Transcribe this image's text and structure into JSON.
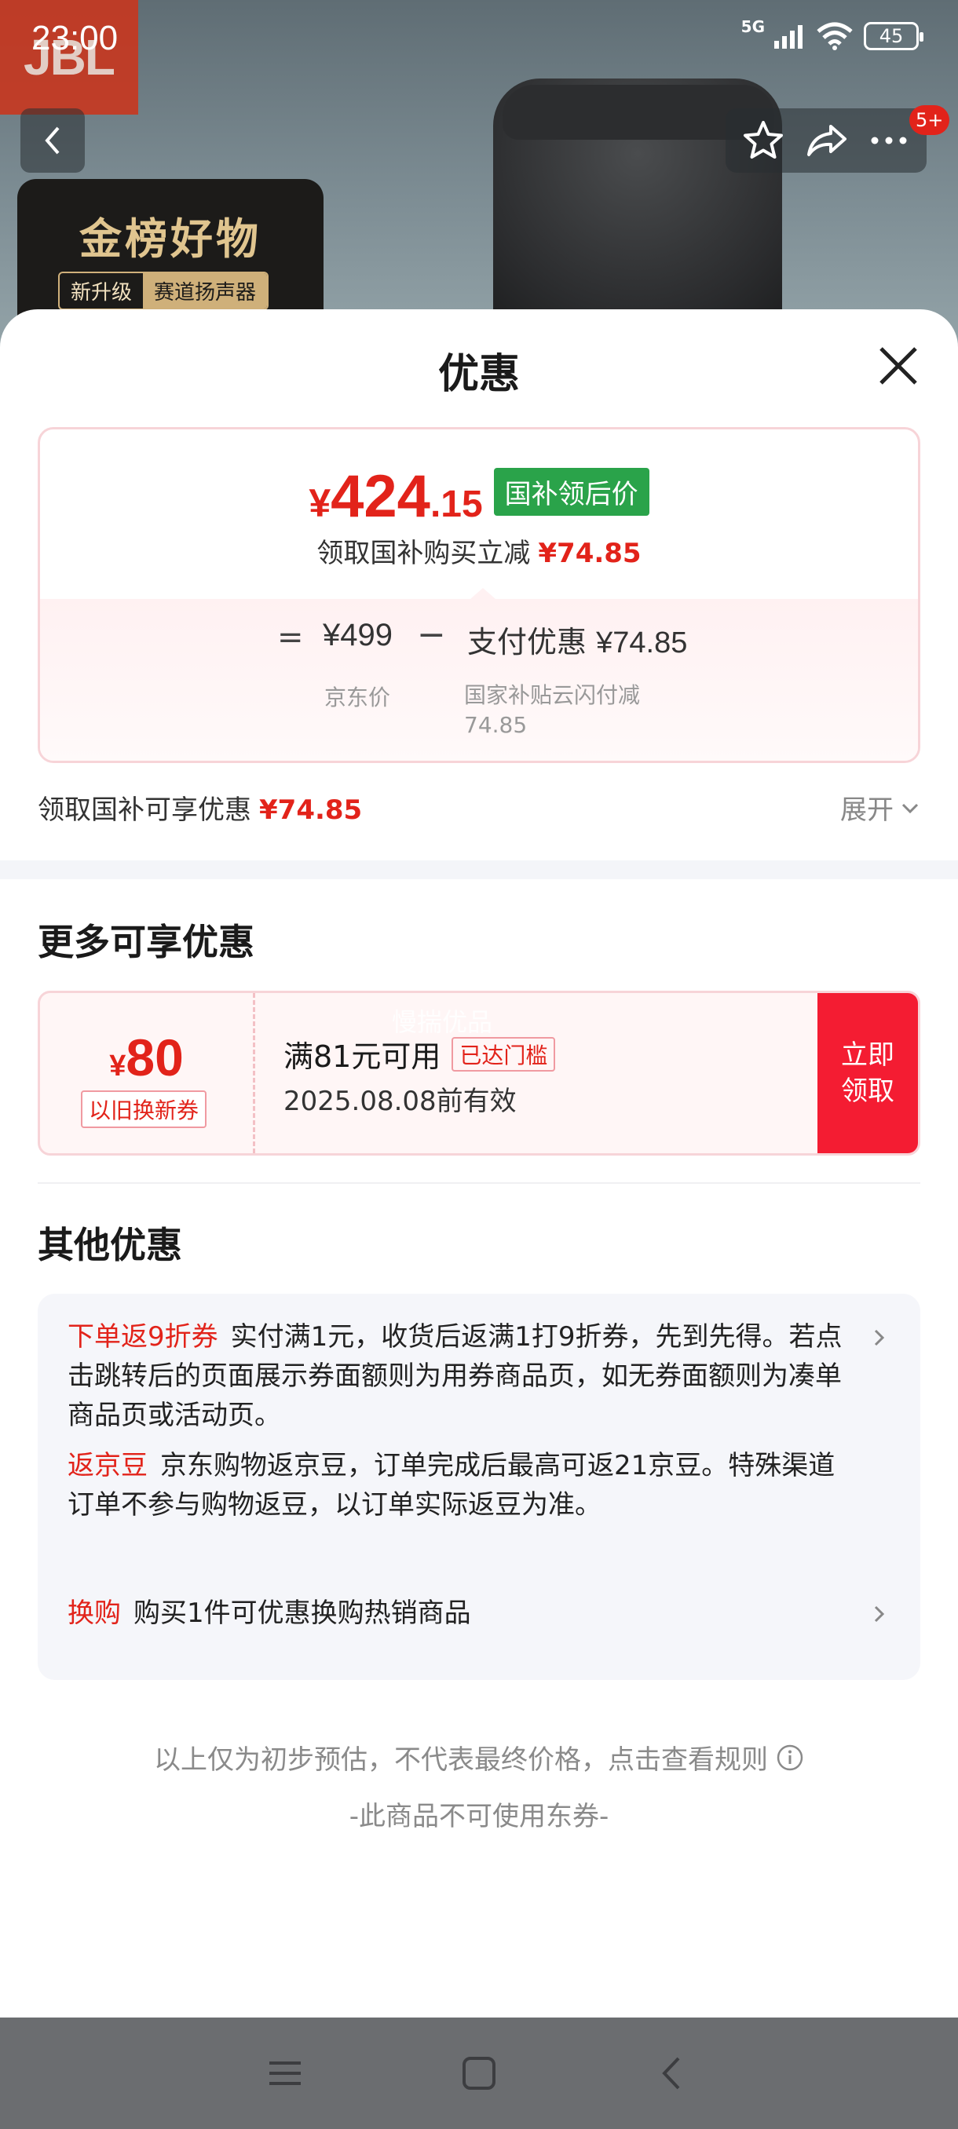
{
  "status_bar": {
    "time": "23:00",
    "network": "5G",
    "battery": "45"
  },
  "background": {
    "brand_logo": "JBL",
    "award_title": "金榜好物",
    "award_tags": [
      "新升级",
      "赛道扬声器"
    ]
  },
  "top_nav": {
    "badge": "5+"
  },
  "sheet": {
    "title": "优惠",
    "price_card": {
      "yen": "¥",
      "price_int": "424",
      "price_dec": ".15",
      "tag": "国补领后价",
      "subtitle": "领取国补购买立减",
      "subtitle_amount": "¥74.85",
      "formula": {
        "equals": "=",
        "jd_price": "¥499",
        "minus": "−",
        "pay_discount_label": "支付优惠",
        "pay_discount_amount": "¥74.85",
        "jd_price_label": "京东价",
        "pay_discount_desc": "国家补贴云闪付减74.85"
      }
    },
    "gb_line": {
      "label": "领取国补可享优惠",
      "amount": "¥74.85",
      "expand": "展开"
    },
    "more_section": {
      "title": "更多可享优惠",
      "coupon": {
        "yen": "¥",
        "amount": "80",
        "type_tag": "以旧换新券",
        "condition": "满81元可用",
        "reached": "已达门槛",
        "valid_until": "2025.08.08前有效",
        "watermark": "慢揣优品",
        "button": "立即领取"
      }
    },
    "other_section": {
      "title": "其他优惠",
      "offers": [
        {
          "tag": "下单返9折券",
          "text": "实付满1元，收货后返满1打9折券，先到先得。若点击跳转后的页面展示券面额则为用券商品页，如无券面额则为凑单商品页或活动页。"
        },
        {
          "tag": "返京豆",
          "text": "京东购物返京豆，订单完成后最高可返21京豆。特殊渠道订单不参与购物返豆，以订单实际返豆为准。"
        },
        {
          "tag": "换购",
          "text": "购买1件可优惠换购热销商品"
        }
      ]
    },
    "footer": {
      "disclaimer": "以上仅为初步预估，不代表最终价格，点击查看规则",
      "no_coupon": "-此商品不可使用东券-"
    }
  },
  "colors": {
    "accent_red": "#e2231a",
    "button_red": "#f41c32",
    "national_subsidy_green": "#2aa34a"
  },
  "icons": [
    "back-arrow-icon",
    "star-icon",
    "share-icon",
    "more-icon",
    "close-icon",
    "chevron-down-icon",
    "chevron-right-icon",
    "info-icon",
    "menu-icon",
    "home-icon",
    "back-icon"
  ]
}
